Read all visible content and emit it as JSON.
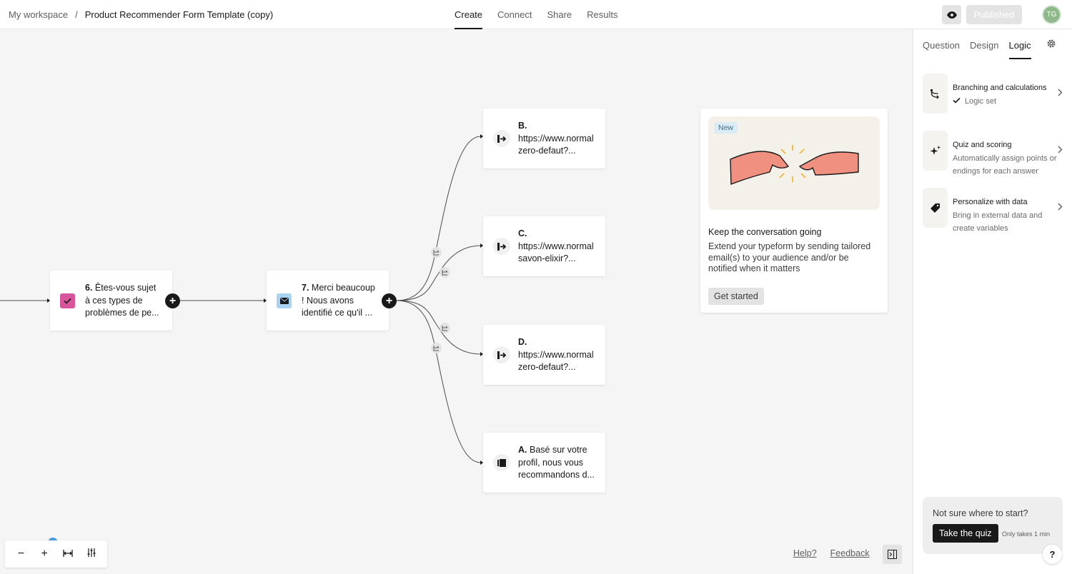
{
  "breadcrumb": {
    "workspace": "My workspace",
    "separator": "/",
    "form_title": "Product Recommender Form Template (copy)"
  },
  "nav": {
    "tabs": [
      "Create",
      "Connect",
      "Share",
      "Results"
    ],
    "active": "Create"
  },
  "header": {
    "published_label": "Published",
    "avatar_initials": "TG"
  },
  "nodes": {
    "q6": {
      "number": "6.",
      "lines": [
        "Êtes-vous sujet",
        "à ces types de",
        "problèmes de pe..."
      ],
      "icon": "checkbox-icon",
      "icon_color": "#d9559b"
    },
    "q7": {
      "number": "7.",
      "lines": [
        "Merci beaucoup",
        "! Nous avons",
        "identifié ce qu'il ..."
      ],
      "icon": "envelope-icon",
      "icon_color": "#a9d3f2"
    },
    "endB": {
      "letter": "B.",
      "lines": [
        "https://www.normal",
        "zero-defaut?..."
      ],
      "icon": "redirect-icon"
    },
    "endC": {
      "letter": "C.",
      "lines": [
        "https://www.normal",
        "savon-elixir?..."
      ],
      "icon": "redirect-icon"
    },
    "endD": {
      "letter": "D.",
      "lines": [
        "https://www.normal",
        "zero-defaut?..."
      ],
      "icon": "redirect-icon"
    },
    "endA": {
      "letter": "A.",
      "first": "Basé sur votre",
      "lines": [
        "profil, nous vous",
        "recommandons d..."
      ],
      "icon": "ending-screen-icon"
    }
  },
  "promo": {
    "badge": "New",
    "title": "Keep the conversation going",
    "body": "Extend your typeform by sending tailored email(s) to your audience and/or be notified when it matters",
    "cta": "Get started"
  },
  "canvas_footer": {
    "help": "Help?",
    "feedback": "Feedback"
  },
  "panel": {
    "tabs": [
      "Question",
      "Design",
      "Logic"
    ],
    "active_tab": "Logic",
    "items": [
      {
        "title": "Branching and calculations",
        "sub": "Logic set",
        "icon": "branch-icon"
      },
      {
        "title": "Quiz and scoring",
        "sub": "Automatically assign points or endings for each answer",
        "icon": "sparkle-icon"
      },
      {
        "title": "Personalize with data",
        "sub": "Bring in external data and create variables",
        "icon": "tag-icon"
      }
    ],
    "quiz": {
      "question": "Not sure where to start?",
      "button": "Take the quiz",
      "note": "Only takes 1 min"
    }
  },
  "colors": {
    "accent_dark": "#191919",
    "canvas_bg": "#f5f5f5",
    "checkbox_pink": "#d9559b",
    "mail_blue": "#a9d3f2"
  }
}
